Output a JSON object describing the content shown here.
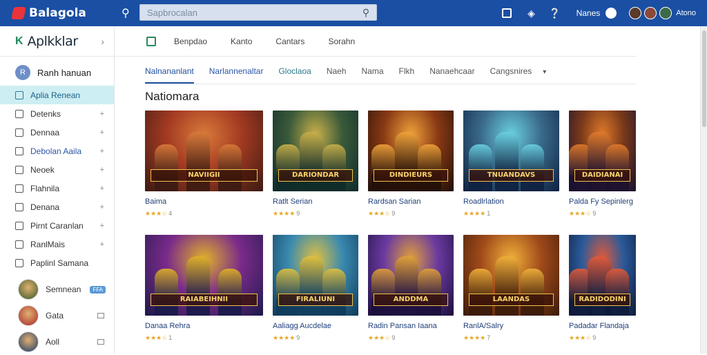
{
  "header": {
    "logo_text": "Balagola",
    "search": {
      "placeholder": "Sapbrocalan",
      "value": ""
    },
    "user_name": "Nanes",
    "lang": "Atono",
    "icons": [
      "search-icon",
      "file-icon",
      "headset-icon",
      "help-icon"
    ],
    "colors": {
      "bar": "#1a4fa3",
      "logo": "#e8343a"
    }
  },
  "sidebar": {
    "brand": "Aplkklar",
    "brand_icon": "K",
    "user": {
      "name": "Ranh hanuan",
      "initial": "R"
    },
    "items": [
      {
        "label": "Aplia Renean",
        "active": true
      },
      {
        "label": "Detenks"
      },
      {
        "label": "Dennaa"
      },
      {
        "label": "Debolan Aaila",
        "blue": true
      },
      {
        "label": "Neoek"
      },
      {
        "label": "Flahnila"
      },
      {
        "label": "Denana"
      },
      {
        "label": "Pirnt Caranlan"
      },
      {
        "label": "RanlMais"
      },
      {
        "label": "Paplinl Samana",
        "no_plus": true
      }
    ],
    "games": [
      {
        "name": "Semnean",
        "badge": "FFA"
      },
      {
        "name": "Gata"
      },
      {
        "name": "Aoll"
      }
    ]
  },
  "subnav": {
    "items": [
      "Benpdao",
      "Kanto",
      "Cantars",
      "Sorahn"
    ]
  },
  "tabs": [
    {
      "label": "Nalnananlant",
      "active": true
    },
    {
      "label": "Narlannenaltar",
      "style": "blue"
    },
    {
      "label": "Gloclaoa",
      "style": "teal"
    },
    {
      "label": "Naeh"
    },
    {
      "label": "Nama"
    },
    {
      "label": "Flkh"
    },
    {
      "label": "Nanaehcaar"
    },
    {
      "label": "Cangsnires",
      "dropdown": true
    }
  ],
  "section_title": "Natiomara",
  "games": [
    {
      "title": "Baima",
      "banner": "NAVIIGII",
      "rating": "★★★☆",
      "count": "4",
      "bg": [
        "#3a1a12",
        "#a33a22",
        "#d97a3a"
      ]
    },
    {
      "title": "Ratlt Serian",
      "banner": "DARIONDAR",
      "rating": "★★★★",
      "count": "9",
      "bg": [
        "#0e2a2a",
        "#3a5a3a",
        "#c9b04a"
      ]
    },
    {
      "title": "Rardsan Sarian",
      "banner": "DINDIEURS",
      "rating": "★★★☆",
      "count": "9",
      "bg": [
        "#1f0e08",
        "#8a3a14",
        "#f0a23a"
      ]
    },
    {
      "title": "Roadlrlation",
      "banner": "TNUANDAVS",
      "rating": "★★★★",
      "count": "1",
      "bg": [
        "#0e2040",
        "#3a6a8a",
        "#6ad0e0"
      ]
    },
    {
      "title": "Palda Fy Sepinlerg",
      "banner": "DAIDIANAI",
      "rating": "★★★☆",
      "count": "9",
      "bg": [
        "#1a1030",
        "#7a3a1a",
        "#e07a2a"
      ]
    },
    {
      "title": "Danaa Rehra",
      "banner": "RAIABEIHNII",
      "rating": "★★★☆",
      "count": "1",
      "bg": [
        "#1a1a4a",
        "#7a2a8a",
        "#e0b02a"
      ]
    },
    {
      "title": "Aaliagg Aucdelae",
      "banner": "FIRALIUNI",
      "rating": "★★★★",
      "count": "9",
      "bg": [
        "#0e3a5a",
        "#3a8ab0",
        "#e0c040"
      ]
    },
    {
      "title": "Radin Pansan Iaana",
      "banner": "ANDDMA",
      "rating": "★★★☆",
      "count": "9",
      "bg": [
        "#1a0e3a",
        "#6a3aa0",
        "#e0a03a"
      ]
    },
    {
      "title": "RanlA/Salry",
      "banner": "LAANDAS",
      "rating": "★★★★",
      "count": "7",
      "bg": [
        "#3a1a0a",
        "#a04a1a",
        "#f0b03a"
      ]
    },
    {
      "title": "Padadar Flandaja",
      "banner": "RADIDODINI",
      "rating": "★★★☆",
      "count": "9",
      "bg": [
        "#0e1a3a",
        "#2a5a9a",
        "#e05a3a"
      ]
    }
  ]
}
